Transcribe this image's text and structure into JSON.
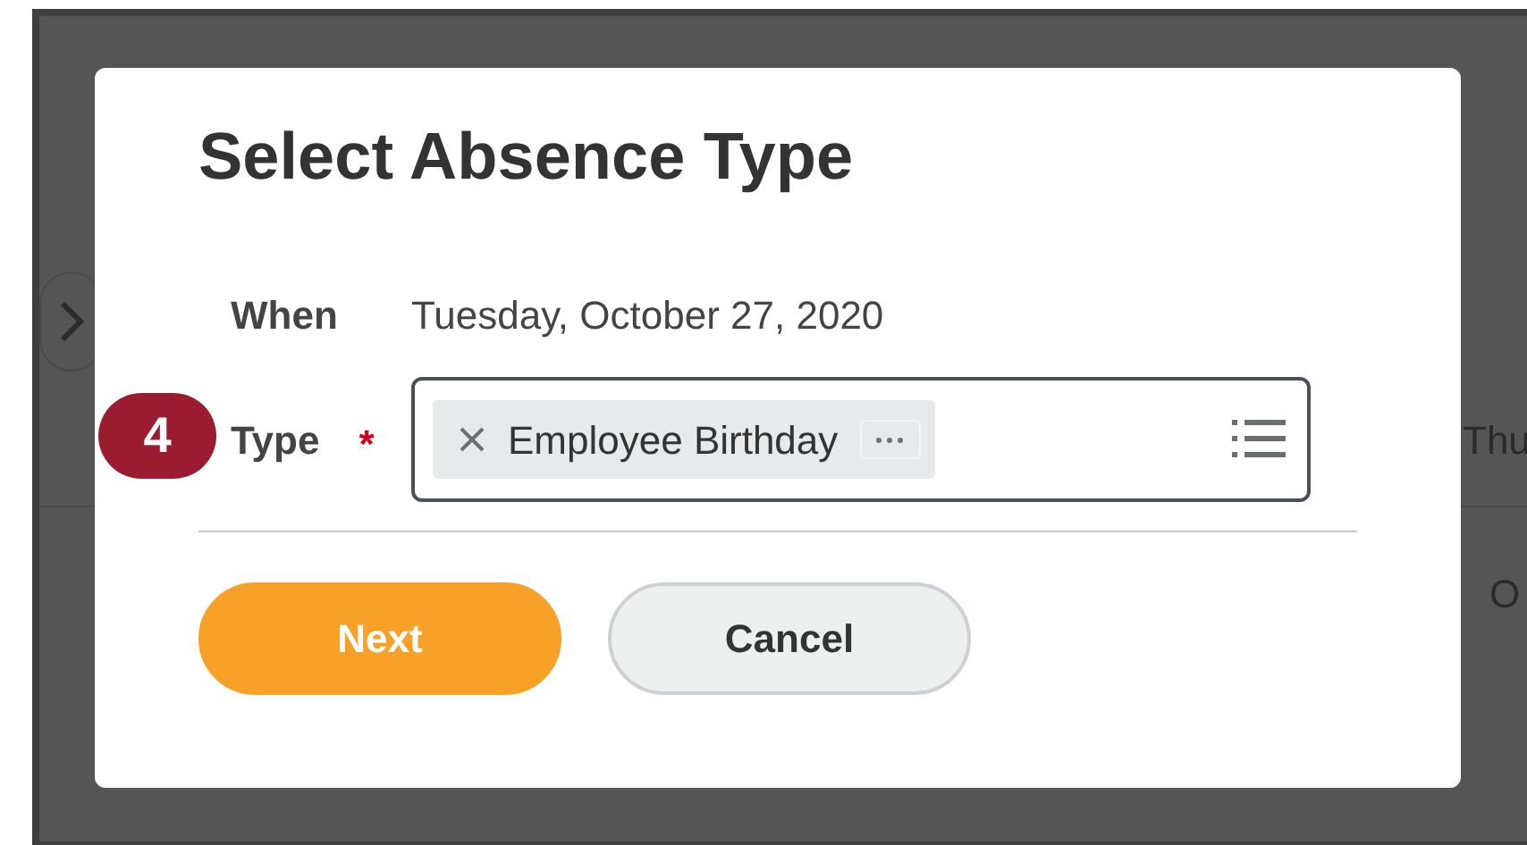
{
  "background": {
    "column_header": "Thu",
    "cell_text": "O"
  },
  "step_badge": "4",
  "dialog": {
    "title": "Select Absence Type",
    "fields": [
      {
        "label": "When",
        "value": "Tuesday, October 27, 2020"
      },
      {
        "label": "Type",
        "required_mark": "*",
        "chips": [
          "Employee Birthday"
        ]
      }
    ],
    "buttons": [
      {
        "label": "Next",
        "kind": "primary"
      },
      {
        "label": "Cancel",
        "kind": "secondary"
      }
    ]
  }
}
